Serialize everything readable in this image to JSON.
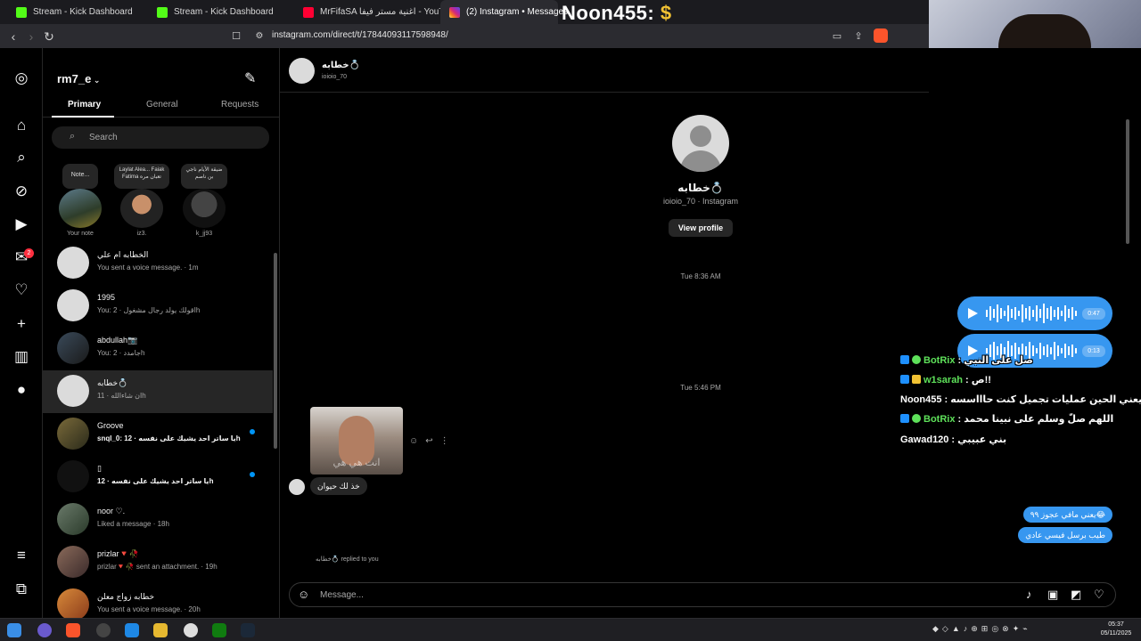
{
  "browser": {
    "tabs": [
      {
        "title": "Stream - Kick Dashboard",
        "icon": "kick-icon"
      },
      {
        "title": "Stream - Kick Dashboard",
        "icon": "kick-icon"
      },
      {
        "title": "MrFifaSA اغنية مستر فيفا - YouTube",
        "icon": "youtube-icon"
      },
      {
        "title": "(2) Instagram • Messages",
        "icon": "instagram-icon"
      }
    ],
    "url": "instagram.com/direct/t/17844093117598948/"
  },
  "overlay": {
    "name": "Noon455:",
    "symbol": "$"
  },
  "rail": {
    "notif_badge": "2"
  },
  "inbox": {
    "account": "rm7_e",
    "tabs": [
      "Primary",
      "General",
      "Requests"
    ],
    "search_placeholder": "Search",
    "notes": [
      {
        "bubble": "Note...",
        "caption": "Your note"
      },
      {
        "bubble": "Laylat Alea... Faiak Fatima تعبان مره",
        "caption": "iz3."
      },
      {
        "bubble": "ضيقة الأيام ناجي بن ناصم",
        "caption": "k_jj93"
      }
    ],
    "conversations": [
      {
        "name": "الخطابه ام علي",
        "preview": "You sent a voice message. · 1m",
        "unread": false
      },
      {
        "name": "1995",
        "preview": "You: اقولك يولد رجال مشغول · 2h",
        "unread": false
      },
      {
        "name": "abdullah📷",
        "preview": "You: جامدد · 2h",
        "unread": false
      },
      {
        "name": "خطابه💍",
        "preview": "ان شاءالله · 11h",
        "unread": false
      },
      {
        "name": "Groove",
        "preview": "snql_0: يا ساتر احد يشيك على نفسه · 12h",
        "unread": true
      },
      {
        "name": "▯",
        "preview": "يا ساتر احد يشيك على نفسه · 12h",
        "unread": true
      },
      {
        "name": "noor ♡.",
        "preview": "Liked a message · 18h",
        "unread": false
      },
      {
        "name": "prizlar🔻🥀",
        "preview": "prizlar🔻🥀 sent an attachment. · 19h",
        "unread": false
      },
      {
        "name": "خطابه زواج معلن",
        "preview": "You sent a voice message. · 20h",
        "unread": false
      }
    ]
  },
  "chat": {
    "header_name": "خطابه💍",
    "header_handle": "ioioio_70",
    "profile_name": "خطابه💍",
    "profile_sub": "ioioio_70 · Instagram",
    "view_profile_label": "View profile",
    "timestamp_1": "Tue 8:36 AM",
    "timestamp_2": "Tue 5:46 PM",
    "voice_messages": [
      {
        "duration": "0:47"
      },
      {
        "duration": "0:13"
      }
    ],
    "image_caption": "انت هي هي",
    "incoming_text": "خذ لك حيوان",
    "reply_note": "خطابه💍 replied to you",
    "outgoing": [
      "يعني مافي عجوز ٩٩😂",
      "طيب برسل فيسي عادي"
    ],
    "composer_placeholder": "Message..."
  },
  "stream_chat": [
    {
      "user": "BotRix",
      "user_color": "#5ee15a",
      "text": ": صل على النبي"
    },
    {
      "user": "w1sarah",
      "user_color": "#5ee15a",
      "text": ": ص!!"
    },
    {
      "user": "Noon455",
      "user_color": "#ffffff",
      "text": ": ا!!!ما يعني الحين عمليات تجميل كنت حاااسسه"
    },
    {
      "user": "BotRix",
      "user_color": "#5ee15a",
      "text": ": اللهم صلّ وسلم على نبينا محمد"
    },
    {
      "user": "Gawad120",
      "user_color": "#ffffff",
      "text": ": بني عبيبي"
    }
  ],
  "taskbar": {
    "time": "05:37",
    "date": "05/11/2025"
  },
  "colors": {
    "accent": "#3797f0",
    "unread_dot": "#0095f6",
    "badge": "#ff3040",
    "kick": "#53fc18"
  }
}
